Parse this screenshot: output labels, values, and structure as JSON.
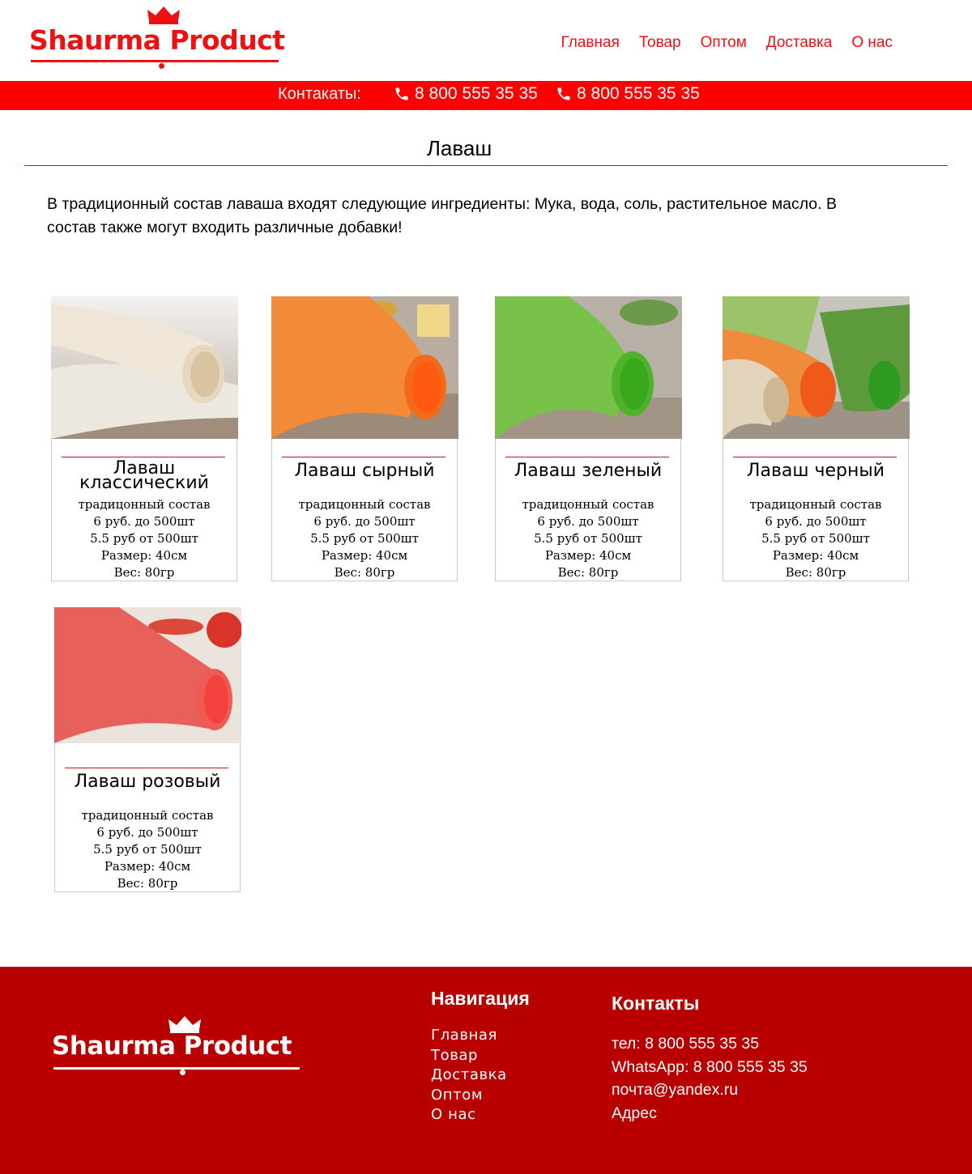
{
  "brand": {
    "name": "Shaurma Product",
    "color": "#ee1111"
  },
  "nav": [
    {
      "label": "Главная"
    },
    {
      "label": "Товар"
    },
    {
      "label": "Оптом"
    },
    {
      "label": "Доставка"
    },
    {
      "label": "О нас"
    }
  ],
  "contact_bar": {
    "label": "Контакаты:",
    "phones": [
      "8 800 555 35 35",
      "8 800 555 35 35"
    ],
    "icon": "phone-icon",
    "color": "#ff0000"
  },
  "page": {
    "title": "Лаваш",
    "intro": "В традиционный состав лаваша входят следующие ингредиенты: Мука, вода, соль, растительное масло. В состав также могут входить различные добавки!"
  },
  "products": [
    {
      "name": "Лаваш классический",
      "composition": "традицонный состав",
      "price1": "6 руб. до 500шт",
      "price2": "5.5 руб от 500шт",
      "size": "Размер: 40см",
      "weight": "Вес: 80гр",
      "image": "white-lavash-roll"
    },
    {
      "name": "Лаваш сырный",
      "composition": "традицонный состав",
      "price1": "6 руб. до 500шт",
      "price2": "5.5 руб от 500шт",
      "size": "Размер: 40см",
      "weight": "Вес: 80гр",
      "image": "orange-lavash-roll"
    },
    {
      "name": "Лаваш зеленый",
      "composition": "традицонный состав",
      "price1": "6 руб. до 500шт",
      "price2": "5.5 руб от 500шт",
      "size": "Размер: 40см",
      "weight": "Вес: 80гр",
      "image": "green-lavash-roll"
    },
    {
      "name": "Лаваш черный",
      "composition": "традицонный состав",
      "price1": "6 руб. до 500шт",
      "price2": "5.5 руб от 500шт",
      "size": "Размер: 40см",
      "weight": "Вес: 80гр",
      "image": "mixed-lavash-rolls"
    },
    {
      "name": "Лаваш розовый",
      "composition": "традицонный состав",
      "price1": "6 руб. до 500шт",
      "price2": "5.5 руб от 500шт",
      "size": "Размер: 40см",
      "weight": "Вес: 80гр",
      "image": "pink-lavash-roll"
    }
  ],
  "footer": {
    "brand": "Shaurma Product",
    "nav_title": "Навигация",
    "nav": [
      {
        "label": "Главная"
      },
      {
        "label": "Товар"
      },
      {
        "label": "Доставка"
      },
      {
        "label": "Оптом"
      },
      {
        "label": "О нас"
      }
    ],
    "contacts_title": "Контакты",
    "phone": "тел: 8 800 555 35 35",
    "whatsapp": "WhatsApp: 8 800 555 35 35",
    "email": "почта@yandex.ru",
    "address": "Адрес",
    "background": "#b80000"
  }
}
